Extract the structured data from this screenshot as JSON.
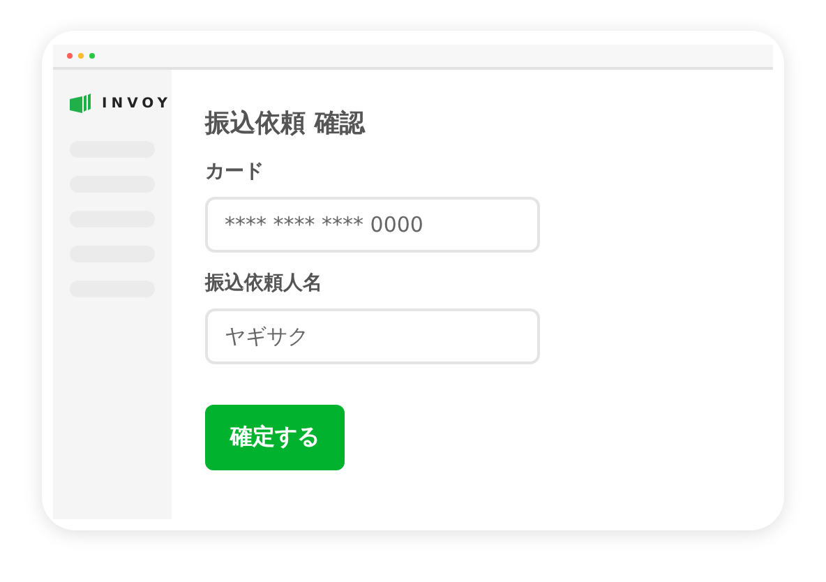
{
  "logo": {
    "text": "INVOY"
  },
  "title": "振込依頼 確認",
  "fields": [
    {
      "label": "カード",
      "value": "**** **** **** 0000"
    },
    {
      "label": "振込依頼人名",
      "value": "ヤギサク"
    }
  ],
  "button": "確定する"
}
